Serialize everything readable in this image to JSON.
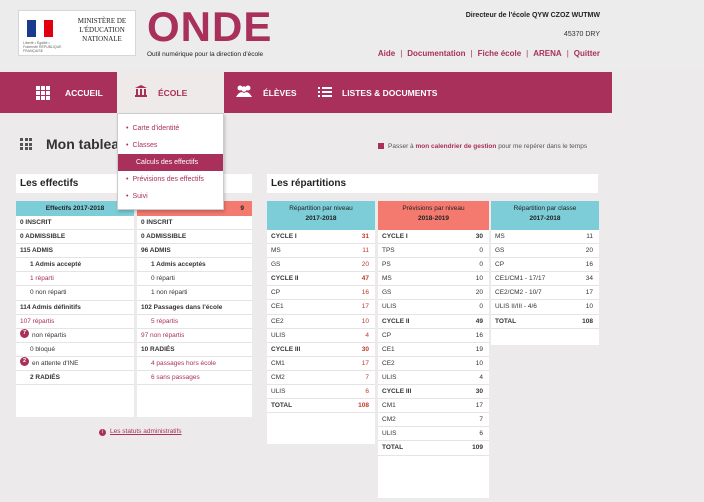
{
  "header": {
    "ministere": "MINISTÈRE DE L'ÉDUCATION NATIONALE",
    "rf": "Liberté • Égalité • Fraternité RÉPUBLIQUE FRANÇAISE",
    "app_name": "ONDE",
    "app_subtitle": "Outil numérique pour la direction d'école",
    "director": "Directeur de l'école QYW CZOZ WUTMW",
    "postal": "45370 DRY",
    "links": [
      "Aide",
      "Documentation",
      "Fiche école",
      "ARENA",
      "Quitter"
    ]
  },
  "nav": {
    "items": [
      {
        "label": "ACCUEIL",
        "icon": "grid-icon"
      },
      {
        "label": "ÉCOLE",
        "icon": "building-icon"
      },
      {
        "label": "ÉLÈVES",
        "icon": "people-icon"
      },
      {
        "label": "LISTES & DOCUMENTS",
        "icon": "list-icon"
      }
    ]
  },
  "dropdown": {
    "items": [
      "Carte d'identité",
      "Classes",
      "Calculs des effectifs",
      "Prévisions des effectifs",
      "Suivi"
    ],
    "highlighted_index": 2
  },
  "page": {
    "title": "Mon tableau",
    "calendar_prefix": "Passer à ",
    "calendar_link": "mon calendrier de gestion",
    "calendar_suffix": " pour me repérer dans le temps"
  },
  "effectifs": {
    "title": "Les effectifs",
    "col1_head": "Effectifs 2017-2018",
    "col2_head_visible": "9",
    "col1": [
      {
        "text": "0 INSCRIT",
        "style": "bold"
      },
      {
        "text": "0 ADMISSIBLE",
        "style": "bold"
      },
      {
        "text": "115 ADMIS",
        "style": "bold"
      },
      {
        "text": "1 Admis accepté",
        "style": "bold-indent"
      },
      {
        "text": "1 réparti",
        "style": "link-indent"
      },
      {
        "text": "0 non réparti",
        "style": "indent"
      },
      {
        "text": "114 Admis définitifs",
        "style": "bold"
      },
      {
        "text": "107 répartis",
        "style": "link"
      },
      {
        "text": "non répartis",
        "badge": "7",
        "style": "plain"
      },
      {
        "text": "0 bloqué",
        "style": "indent"
      },
      {
        "text": "en attente d'INE",
        "badge": "2",
        "style": "plain"
      },
      {
        "text": "2 RADIÉS",
        "style": "bold-indent"
      }
    ],
    "col2": [
      {
        "text": "0 INSCRIT",
        "style": "bold"
      },
      {
        "text": "0 ADMISSIBLE",
        "style": "bold"
      },
      {
        "text": "96 ADMIS",
        "style": "bold"
      },
      {
        "text": "1 Admis acceptés",
        "style": "bold-indent"
      },
      {
        "text": "0 réparti",
        "style": "indent"
      },
      {
        "text": "1 non réparti",
        "style": "indent"
      },
      {
        "text": "102 Passages dans l'école",
        "style": "bold"
      },
      {
        "text": "5 répartis",
        "style": "link-indent"
      },
      {
        "text": "97 non répartis",
        "style": "link"
      },
      {
        "text": "10 RADIÉS",
        "style": "bold"
      },
      {
        "text": "4 passages hors école",
        "style": "link-indent"
      },
      {
        "text": "6 sans passages",
        "style": "link-indent"
      }
    ],
    "statut_link": "Les statuts administratifs"
  },
  "repartitions": {
    "title": "Les répartitions",
    "niveau": {
      "head": "Répartition par niveau",
      "year": "2017-2018",
      "rows": [
        {
          "label": "CYCLE I",
          "value": "31",
          "bold": true,
          "red": true
        },
        {
          "label": "MS",
          "value": "11",
          "red": true
        },
        {
          "label": "GS",
          "value": "20",
          "red": true
        },
        {
          "label": "CYCLE II",
          "value": "47",
          "bold": true,
          "red": true
        },
        {
          "label": "CP",
          "value": "16",
          "red": true
        },
        {
          "label": "CE1",
          "value": "17",
          "red": true
        },
        {
          "label": "CE2",
          "value": "10",
          "red": true
        },
        {
          "label": "ULIS",
          "value": "4",
          "red": true
        },
        {
          "label": "CYCLE III",
          "value": "30",
          "bold": true,
          "red": true
        },
        {
          "label": "CM1",
          "value": "17",
          "red": true
        },
        {
          "label": "CM2",
          "value": "7",
          "red": true
        },
        {
          "label": "ULIS",
          "value": "6",
          "red": true
        },
        {
          "label": "TOTAL",
          "value": "108",
          "bold": true,
          "red": true
        }
      ]
    },
    "previsions": {
      "head": "Prévisions par niveau",
      "year": "2018-2019",
      "rows": [
        {
          "label": "CYCLE I",
          "value": "30",
          "bold": true
        },
        {
          "label": "TPS",
          "value": "0"
        },
        {
          "label": "PS",
          "value": "0"
        },
        {
          "label": "MS",
          "value": "10"
        },
        {
          "label": "GS",
          "value": "20"
        },
        {
          "label": "ULIS",
          "value": "0"
        },
        {
          "label": "CYCLE II",
          "value": "49",
          "bold": true
        },
        {
          "label": "CP",
          "value": "16"
        },
        {
          "label": "CE1",
          "value": "19"
        },
        {
          "label": "CE2",
          "value": "10"
        },
        {
          "label": "ULIS",
          "value": "4"
        },
        {
          "label": "CYCLE III",
          "value": "30",
          "bold": true
        },
        {
          "label": "CM1",
          "value": "17"
        },
        {
          "label": "CM2",
          "value": "7"
        },
        {
          "label": "ULIS",
          "value": "6"
        },
        {
          "label": "TOTAL",
          "value": "109",
          "bold": true
        }
      ]
    },
    "classe": {
      "head": "Répartition par classe",
      "year": "2017-2018",
      "rows": [
        {
          "label": "MS",
          "value": "11"
        },
        {
          "label": "GS",
          "value": "20"
        },
        {
          "label": "CP",
          "value": "16"
        },
        {
          "label": "CE1/CM1 - 17/17",
          "value": "34"
        },
        {
          "label": "CE2/CM2 - 10/7",
          "value": "17"
        },
        {
          "label": "ULIS II/III - 4/6",
          "value": "10"
        },
        {
          "label": "TOTAL",
          "value": "108",
          "bold": true
        }
      ]
    }
  },
  "colors": {
    "brand": "#a9305b",
    "header_blue": "#7ccdd7",
    "header_salmon": "#f47a6f"
  }
}
